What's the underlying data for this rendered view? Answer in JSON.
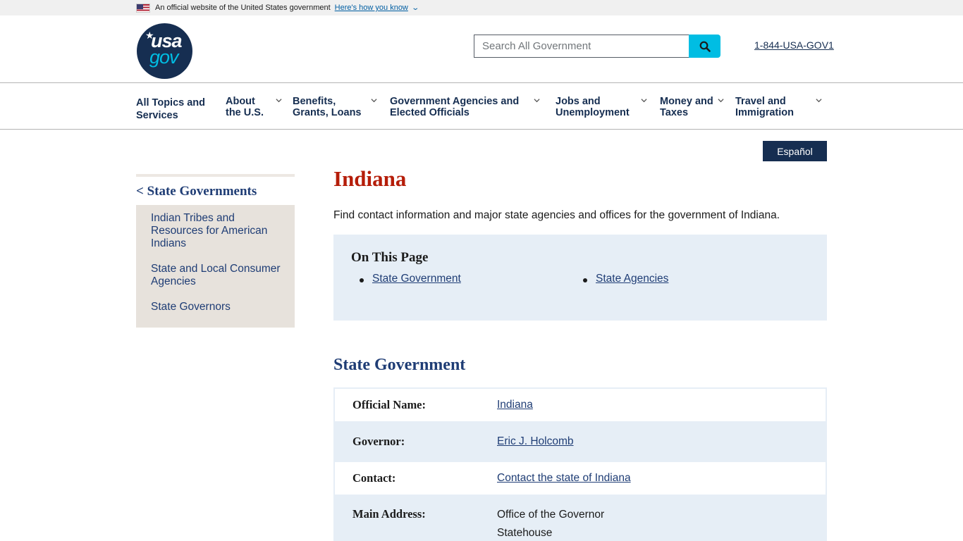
{
  "gov_banner": {
    "official_text": "An official website of the United States government",
    "how_link": "Here's how you know"
  },
  "header": {
    "logo_top": "usa",
    "logo_bottom": "gov",
    "search_placeholder": "Search All Government",
    "phone": "1-844-USA-GOV1"
  },
  "nav": {
    "items": [
      {
        "label": "All Topics and Services",
        "has_dropdown": false
      },
      {
        "label": "About the U.S.",
        "has_dropdown": true
      },
      {
        "label": "Benefits, Grants, Loans",
        "has_dropdown": true
      },
      {
        "label": "Government Agencies and Elected Officials",
        "has_dropdown": true
      },
      {
        "label": "Jobs and Unemployment",
        "has_dropdown": true
      },
      {
        "label": "Money and Taxes",
        "has_dropdown": true
      },
      {
        "label": "Travel and Immigration",
        "has_dropdown": true
      }
    ],
    "lines": [
      [
        "All Topics and",
        "Services"
      ],
      [
        "About",
        "the U.S."
      ],
      [
        "Benefits,",
        "Grants, Loans"
      ],
      [
        "Government Agencies and",
        "Elected Officials"
      ],
      [
        "Jobs and",
        "Unemployment"
      ],
      [
        "Money and",
        "Taxes"
      ],
      [
        "Travel and",
        "Immigration"
      ]
    ]
  },
  "language_button": "Español",
  "sidenav": {
    "parent": "< State Governments",
    "children": [
      "Indian Tribes and Resources for American Indians",
      "State and Local Consumer Agencies",
      "State Governors"
    ]
  },
  "main": {
    "title": "Indiana",
    "intro": "Find contact information and major state agencies and offices for the government of Indiana.",
    "on_this_page": {
      "heading": "On This Page",
      "links": [
        "State Government",
        "State Agencies"
      ]
    },
    "section_title": "State Government",
    "table": [
      {
        "label": "Official Name:",
        "value": "Indiana",
        "is_link": true
      },
      {
        "label": "Governor:",
        "value": "Eric J. Holcomb",
        "is_link": true
      },
      {
        "label": "Contact:",
        "value": "Contact the state of Indiana",
        "is_link": true
      },
      {
        "label": "Main Address:",
        "lines": [
          "Office of the Governor",
          "Statehouse"
        ],
        "is_link": false
      }
    ]
  },
  "colors": {
    "navy": "#162e51",
    "link_blue": "#1f3d75",
    "cyan": "#00bde3",
    "title_red": "#b51d09",
    "panel_blue": "#e6eef6",
    "sidenav_beige": "#e7e2dc"
  }
}
